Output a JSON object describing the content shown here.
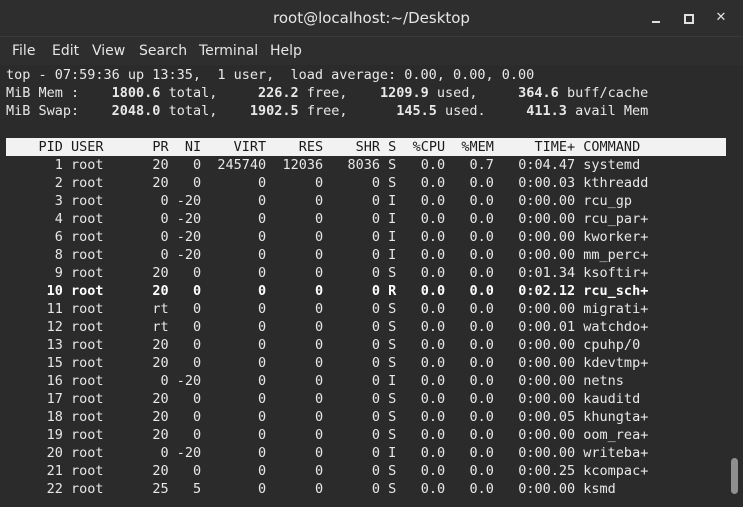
{
  "window": {
    "title": "root@localhost:~/Desktop",
    "minimize_icon": "minimize-icon",
    "maximize_icon": "maximize-icon",
    "close_icon": "close-icon"
  },
  "menu": [
    "File",
    "Edit",
    "View",
    "Search",
    "Terminal",
    "Help"
  ],
  "summary": {
    "line1": "top - 07:59:36 up 13:35,  1 user,  load average: 0.00, 0.00, 0.00",
    "mem_label": "MiB Mem :",
    "mem_total": "1800.6",
    "mem_total_label": "total,",
    "mem_free": "226.2",
    "mem_free_label": "free,",
    "mem_used": "1209.9",
    "mem_used_label": "used,",
    "mem_cache": "364.6",
    "mem_cache_label": "buff/cache",
    "swap_label": "MiB Swap:",
    "swap_total": "2048.0",
    "swap_total_label": "total,",
    "swap_free": "1902.5",
    "swap_free_label": "free,",
    "swap_used": "145.5",
    "swap_used_label": "used.",
    "swap_avail": "411.3",
    "swap_avail_label": "avail Mem"
  },
  "columns": [
    "PID",
    "USER",
    "PR",
    "NI",
    "VIRT",
    "RES",
    "SHR",
    "S",
    "%CPU",
    "%MEM",
    "TIME+",
    "COMMAND"
  ],
  "processes": [
    {
      "pid": "1",
      "user": "root",
      "pr": "20",
      "ni": "0",
      "virt": "245740",
      "res": "12036",
      "shr": "8036",
      "s": "S",
      "cpu": "0.0",
      "mem": "0.7",
      "time": "0:04.47",
      "cmd": "systemd"
    },
    {
      "pid": "2",
      "user": "root",
      "pr": "20",
      "ni": "0",
      "virt": "0",
      "res": "0",
      "shr": "0",
      "s": "S",
      "cpu": "0.0",
      "mem": "0.0",
      "time": "0:00.03",
      "cmd": "kthreadd"
    },
    {
      "pid": "3",
      "user": "root",
      "pr": "0",
      "ni": "-20",
      "virt": "0",
      "res": "0",
      "shr": "0",
      "s": "I",
      "cpu": "0.0",
      "mem": "0.0",
      "time": "0:00.00",
      "cmd": "rcu_gp"
    },
    {
      "pid": "4",
      "user": "root",
      "pr": "0",
      "ni": "-20",
      "virt": "0",
      "res": "0",
      "shr": "0",
      "s": "I",
      "cpu": "0.0",
      "mem": "0.0",
      "time": "0:00.00",
      "cmd": "rcu_par+"
    },
    {
      "pid": "6",
      "user": "root",
      "pr": "0",
      "ni": "-20",
      "virt": "0",
      "res": "0",
      "shr": "0",
      "s": "I",
      "cpu": "0.0",
      "mem": "0.0",
      "time": "0:00.00",
      "cmd": "kworker+"
    },
    {
      "pid": "8",
      "user": "root",
      "pr": "0",
      "ni": "-20",
      "virt": "0",
      "res": "0",
      "shr": "0",
      "s": "I",
      "cpu": "0.0",
      "mem": "0.0",
      "time": "0:00.00",
      "cmd": "mm_perc+"
    },
    {
      "pid": "9",
      "user": "root",
      "pr": "20",
      "ni": "0",
      "virt": "0",
      "res": "0",
      "shr": "0",
      "s": "S",
      "cpu": "0.0",
      "mem": "0.0",
      "time": "0:01.34",
      "cmd": "ksoftir+"
    },
    {
      "pid": "10",
      "user": "root",
      "pr": "20",
      "ni": "0",
      "virt": "0",
      "res": "0",
      "shr": "0",
      "s": "R",
      "cpu": "0.0",
      "mem": "0.0",
      "time": "0:02.12",
      "cmd": "rcu_sch+",
      "highlight": true
    },
    {
      "pid": "11",
      "user": "root",
      "pr": "rt",
      "ni": "0",
      "virt": "0",
      "res": "0",
      "shr": "0",
      "s": "S",
      "cpu": "0.0",
      "mem": "0.0",
      "time": "0:00.00",
      "cmd": "migrati+"
    },
    {
      "pid": "12",
      "user": "root",
      "pr": "rt",
      "ni": "0",
      "virt": "0",
      "res": "0",
      "shr": "0",
      "s": "S",
      "cpu": "0.0",
      "mem": "0.0",
      "time": "0:00.01",
      "cmd": "watchdo+"
    },
    {
      "pid": "13",
      "user": "root",
      "pr": "20",
      "ni": "0",
      "virt": "0",
      "res": "0",
      "shr": "0",
      "s": "S",
      "cpu": "0.0",
      "mem": "0.0",
      "time": "0:00.00",
      "cmd": "cpuhp/0"
    },
    {
      "pid": "15",
      "user": "root",
      "pr": "20",
      "ni": "0",
      "virt": "0",
      "res": "0",
      "shr": "0",
      "s": "S",
      "cpu": "0.0",
      "mem": "0.0",
      "time": "0:00.00",
      "cmd": "kdevtmp+"
    },
    {
      "pid": "16",
      "user": "root",
      "pr": "0",
      "ni": "-20",
      "virt": "0",
      "res": "0",
      "shr": "0",
      "s": "I",
      "cpu": "0.0",
      "mem": "0.0",
      "time": "0:00.00",
      "cmd": "netns"
    },
    {
      "pid": "17",
      "user": "root",
      "pr": "20",
      "ni": "0",
      "virt": "0",
      "res": "0",
      "shr": "0",
      "s": "S",
      "cpu": "0.0",
      "mem": "0.0",
      "time": "0:00.00",
      "cmd": "kauditd"
    },
    {
      "pid": "18",
      "user": "root",
      "pr": "20",
      "ni": "0",
      "virt": "0",
      "res": "0",
      "shr": "0",
      "s": "S",
      "cpu": "0.0",
      "mem": "0.0",
      "time": "0:00.05",
      "cmd": "khungta+"
    },
    {
      "pid": "19",
      "user": "root",
      "pr": "20",
      "ni": "0",
      "virt": "0",
      "res": "0",
      "shr": "0",
      "s": "S",
      "cpu": "0.0",
      "mem": "0.0",
      "time": "0:00.00",
      "cmd": "oom_rea+"
    },
    {
      "pid": "20",
      "user": "root",
      "pr": "0",
      "ni": "-20",
      "virt": "0",
      "res": "0",
      "shr": "0",
      "s": "I",
      "cpu": "0.0",
      "mem": "0.0",
      "time": "0:00.00",
      "cmd": "writeba+"
    },
    {
      "pid": "21",
      "user": "root",
      "pr": "20",
      "ni": "0",
      "virt": "0",
      "res": "0",
      "shr": "0",
      "s": "S",
      "cpu": "0.0",
      "mem": "0.0",
      "time": "0:00.25",
      "cmd": "kcompac+"
    },
    {
      "pid": "22",
      "user": "root",
      "pr": "25",
      "ni": "5",
      "virt": "0",
      "res": "0",
      "shr": "0",
      "s": "S",
      "cpu": "0.0",
      "mem": "0.0",
      "time": "0:00.00",
      "cmd": "ksmd"
    }
  ],
  "colors": {
    "background": "#2b2b2b",
    "text": "#e8e8e8",
    "header_bg": "#f2f2f2",
    "header_text": "#1b1b1b"
  }
}
